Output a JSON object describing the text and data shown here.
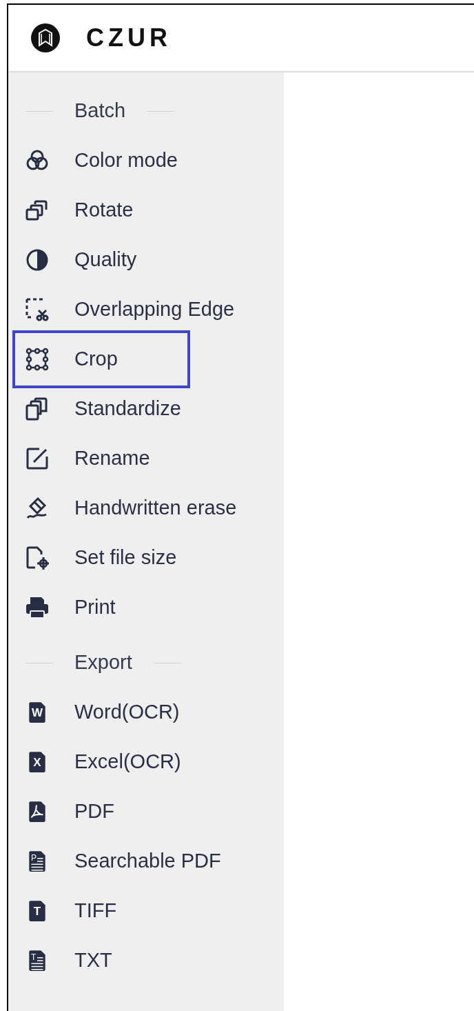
{
  "brand": {
    "name": "CZUR"
  },
  "sections": [
    {
      "title": "Batch",
      "items": [
        {
          "label": "Color mode",
          "kind": "circles",
          "highlighted": false
        },
        {
          "label": "Rotate",
          "kind": "rotate",
          "highlighted": false
        },
        {
          "label": "Quality",
          "kind": "contrast",
          "highlighted": false
        },
        {
          "label": "Overlapping Edge",
          "kind": "dashcut",
          "highlighted": false
        },
        {
          "label": "Crop",
          "kind": "crop",
          "highlighted": true
        },
        {
          "label": "Standardize",
          "kind": "stack",
          "highlighted": false
        },
        {
          "label": "Rename",
          "kind": "edit",
          "highlighted": false
        },
        {
          "label": "Handwritten erase",
          "kind": "eraser",
          "highlighted": false
        },
        {
          "label": "Set file size",
          "kind": "filetarget",
          "highlighted": false
        },
        {
          "label": "Print",
          "kind": "printer",
          "highlighted": false
        }
      ]
    },
    {
      "title": "Export",
      "items": [
        {
          "label": "Word(OCR)",
          "kind": "fileletter",
          "icon_text": "W",
          "highlighted": false
        },
        {
          "label": "Excel(OCR)",
          "kind": "fileletter",
          "icon_text": "X",
          "highlighted": false
        },
        {
          "label": "PDF",
          "kind": "pdf",
          "highlighted": false
        },
        {
          "label": "Searchable PDF",
          "kind": "filelines",
          "icon_text": "P",
          "highlighted": false
        },
        {
          "label": "TIFF",
          "kind": "fileletter",
          "icon_text": "T",
          "highlighted": false
        },
        {
          "label": "TXT",
          "kind": "filelines",
          "icon_text": "T",
          "highlighted": false
        }
      ]
    }
  ]
}
